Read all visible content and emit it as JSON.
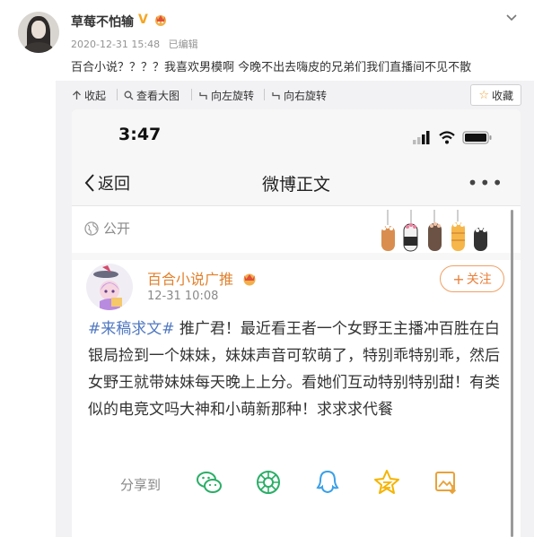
{
  "post": {
    "username": "草莓不怕输",
    "verified_badge": "V",
    "date": "2020-12-31 15:48",
    "edited": "已编辑",
    "text": "百合小说？？？？我喜欢男模啊 今晚不出去嗨皮的兄弟们我们直播间不见不散"
  },
  "toolbar": {
    "collapse": "收起",
    "view_large": "查看大图",
    "rotate_left": "向左旋转",
    "rotate_right": "向右旋转",
    "favorite": "收藏"
  },
  "screenshot": {
    "status_time": "3:47",
    "back_label": "返回",
    "nav_title": "微博正文",
    "more": "•••",
    "visibility": "公开",
    "author_name": "百合小说广推",
    "author_time": "12-31 10:08",
    "follow_label": "关注",
    "follow_plus": "+",
    "content_tag": "#来稿求文#",
    "content_text": " 推广君！最近看王者一个女野王主播冲百胜在白银局捡到一个妹妹，妹妹声音可软萌了，特别乖特别乖，然后女野王就带妹妹每天晚上上分。看她们互动特别特别甜！有类似的电竞文吗大神和小萌新那种！求求求代餐",
    "share_label": "分享到",
    "share_targets": [
      "wechat-icon",
      "moments-icon",
      "qq-icon",
      "qzone-icon",
      "save-image-icon"
    ]
  },
  "colors": {
    "accent_orange": "#e2812d",
    "tag_blue": "#5179c2",
    "share_green": "#2aae67",
    "qq_blue": "#3aa0e8",
    "star_yellow": "#f5b400"
  }
}
